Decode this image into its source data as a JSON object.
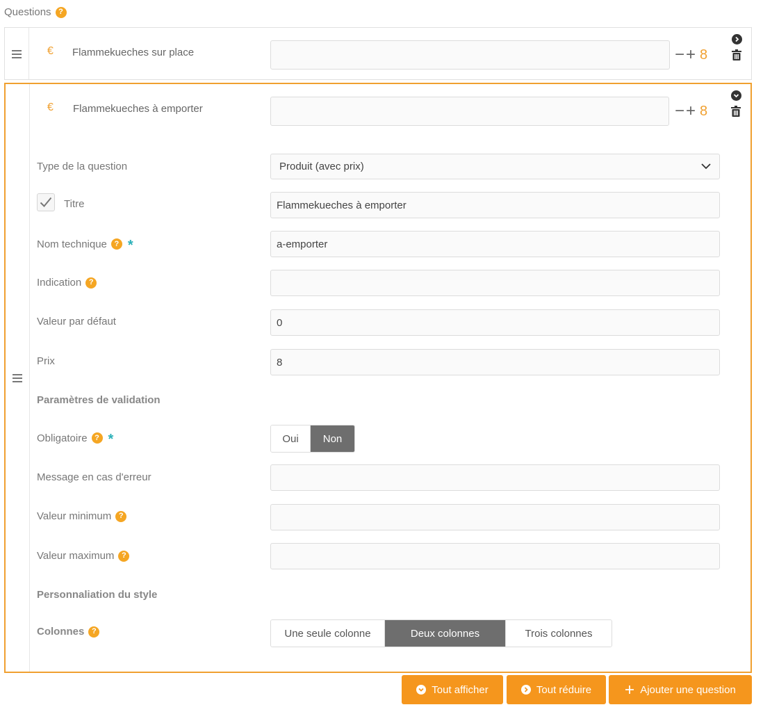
{
  "section": {
    "title": "Questions"
  },
  "questions": [
    {
      "icon": "euro-icon",
      "symbol": "€",
      "name": "Flammekueches sur place",
      "count": "8"
    },
    {
      "icon": "euro-icon",
      "symbol": "€",
      "name": "Flammekueches à emporter",
      "count": "8"
    }
  ],
  "stepper": {
    "minus": "−",
    "plus": "+"
  },
  "form": {
    "type_label": "Type de la question",
    "type_value": "Produit (avec prix)",
    "title_label": "Titre",
    "title_value": "Flammekueches à emporter",
    "tech_label": "Nom technique",
    "tech_value": "a-emporter",
    "indication_label": "Indication",
    "indication_value": "",
    "default_label": "Valeur par défaut",
    "default_value": "0",
    "price_label": "Prix",
    "price_value": "8",
    "validation_heading": "Paramètres de validation",
    "required_label": "Obligatoire",
    "required_options": [
      "Oui",
      "Non"
    ],
    "required_selected": "Non",
    "error_label": "Message en cas d'erreur",
    "error_value": "",
    "min_label": "Valeur minimum",
    "min_value": "",
    "max_label": "Valeur maximum",
    "max_value": "",
    "style_heading": "Personnaliation du style",
    "columns_label": "Colonnes",
    "columns_options": [
      "Une seule colonne",
      "Deux colonnes",
      "Trois colonnes"
    ],
    "columns_selected": "Deux colonnes"
  },
  "help_mark": "?",
  "required_mark": "*",
  "buttons": {
    "show_all": "Tout afficher",
    "collapse_all": "Tout réduire",
    "add_question": "Ajouter une question"
  },
  "colors": {
    "accent": "#f5961d",
    "required": "#2bb0b8",
    "active_toggle": "#6e6e6e"
  }
}
